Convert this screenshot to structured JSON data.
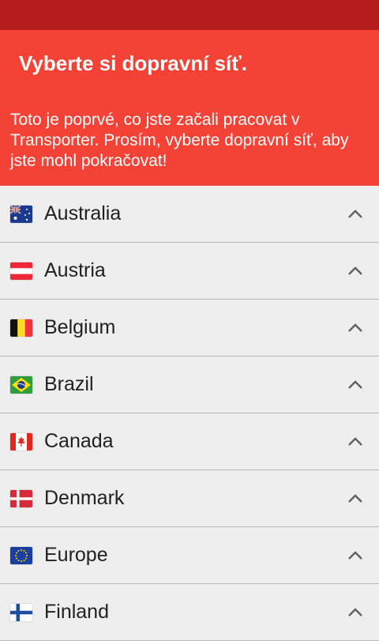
{
  "header": {
    "title": "Vyberte si dopravní síť.",
    "description": "Toto je poprvé, co jste začali pracovat v Transporter. Prosím, vyberte dopravní síť, aby jste mohl pokračovat!"
  },
  "colors": {
    "status_bar": "#b71c1c",
    "header": "#f44336",
    "list_bg": "#eeeeee"
  },
  "networks": [
    {
      "label": "Australia",
      "icon": "flag-australia-icon"
    },
    {
      "label": "Austria",
      "icon": "flag-austria-icon"
    },
    {
      "label": "Belgium",
      "icon": "flag-belgium-icon"
    },
    {
      "label": "Brazil",
      "icon": "flag-brazil-icon"
    },
    {
      "label": "Canada",
      "icon": "flag-canada-icon"
    },
    {
      "label": "Denmark",
      "icon": "flag-denmark-icon"
    },
    {
      "label": "Europe",
      "icon": "flag-europe-icon"
    },
    {
      "label": "Finland",
      "icon": "flag-finland-icon"
    }
  ]
}
